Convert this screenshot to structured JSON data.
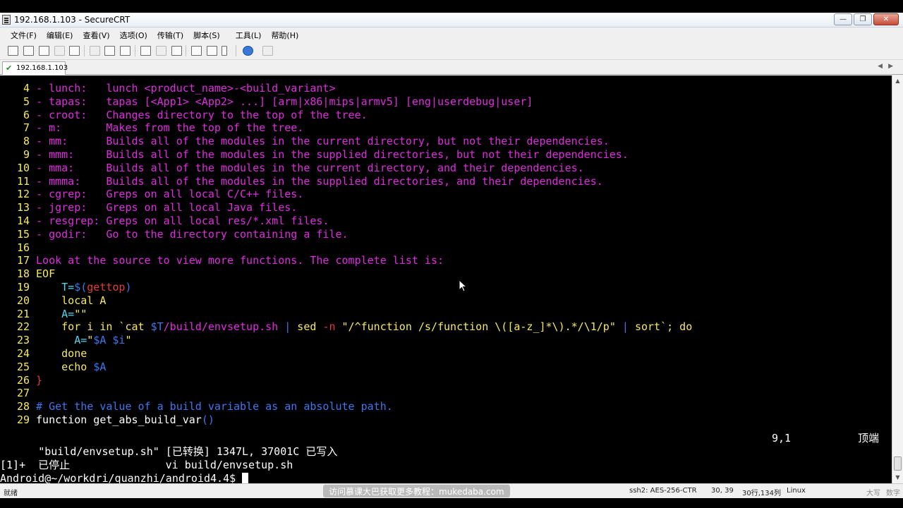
{
  "window": {
    "title": "192.168.1.103 - SecureCRT",
    "controls": [
      "—",
      "❐",
      "✕"
    ]
  },
  "menu": [
    "文件(F)",
    "编辑(E)",
    "查看(V)",
    "选项(O)",
    "传输(T)",
    "脚本(S)",
    "工具(L)",
    "帮助(H)"
  ],
  "tabs": [
    {
      "label": "192.168.1.103",
      "status": "connected"
    }
  ],
  "terminal": {
    "lines": [
      {
        "n": "4",
        "segs": [
          [
            "m",
            " - lunch:   lunch <product_name>-<build_variant>"
          ]
        ]
      },
      {
        "n": "5",
        "segs": [
          [
            "m",
            " - tapas:   tapas [<App1> <App2> ...] [arm|x86|mips|armv5] [eng|userdebug|user]"
          ]
        ]
      },
      {
        "n": "6",
        "segs": [
          [
            "m",
            " - croot:   Changes directory to the top of the tree."
          ]
        ]
      },
      {
        "n": "7",
        "segs": [
          [
            "m",
            " - m:       Makes from the top of the tree."
          ]
        ]
      },
      {
        "n": "8",
        "segs": [
          [
            "m",
            " - mm:      Builds all of the modules in the current directory, but not their dependencies."
          ]
        ]
      },
      {
        "n": "9",
        "segs": [
          [
            "m",
            " - mmm:     Builds all of the modules in the supplied directories, but not their dependencies."
          ]
        ]
      },
      {
        "n": "10",
        "segs": [
          [
            "m",
            " - mma:     Builds all of the modules in the current directory, and their dependencies."
          ]
        ]
      },
      {
        "n": "11",
        "segs": [
          [
            "m",
            " - mmma:    Builds all of the modules in the supplied directories, and their dependencies."
          ]
        ]
      },
      {
        "n": "12",
        "segs": [
          [
            "m",
            " - cgrep:   Greps on all local C/C++ files."
          ]
        ]
      },
      {
        "n": "13",
        "segs": [
          [
            "m",
            " - jgrep:   Greps on all local Java files."
          ]
        ]
      },
      {
        "n": "14",
        "segs": [
          [
            "m",
            " - resgrep: Greps on all local res/*.xml files."
          ]
        ]
      },
      {
        "n": "15",
        "segs": [
          [
            "m",
            " - godir:   Go to the directory containing a file."
          ]
        ]
      },
      {
        "n": "16",
        "segs": []
      },
      {
        "n": "17",
        "segs": [
          [
            "m",
            " Look at the source to view more functions. The complete list is:"
          ]
        ]
      },
      {
        "n": "18",
        "segs": [
          [
            "y",
            " EOF"
          ]
        ]
      },
      {
        "n": "19",
        "segs": [
          [
            "c",
            "     T="
          ],
          [
            "b",
            "$("
          ],
          [
            "r",
            "gettop"
          ],
          [
            "b",
            ")"
          ]
        ]
      },
      {
        "n": "20",
        "segs": [
          [
            "y",
            "     local A"
          ]
        ]
      },
      {
        "n": "21",
        "segs": [
          [
            "c",
            "     A="
          ],
          [
            "y",
            "\"\""
          ]
        ]
      },
      {
        "n": "22",
        "segs": [
          [
            "y",
            "     for i in `cat "
          ],
          [
            "b",
            "$T"
          ],
          [
            "m",
            "/build/envsetup.sh"
          ],
          [
            "y",
            " "
          ],
          [
            "b",
            "|"
          ],
          [
            "y",
            " sed "
          ],
          [
            "r",
            "-n"
          ],
          [
            "y",
            " \"/^function /s/function \\([a-z_]*\\).*/\\1/p\" "
          ],
          [
            "b",
            "|"
          ],
          [
            "y",
            " sort`; do"
          ]
        ]
      },
      {
        "n": "23",
        "segs": [
          [
            "c",
            "       A="
          ],
          [
            "y",
            "\""
          ],
          [
            "b",
            "$A $i"
          ],
          [
            "y",
            "\""
          ]
        ]
      },
      {
        "n": "24",
        "segs": [
          [
            "y",
            "     done"
          ]
        ]
      },
      {
        "n": "25",
        "segs": [
          [
            "y",
            "     echo "
          ],
          [
            "b",
            "$A"
          ]
        ]
      },
      {
        "n": "26",
        "segs": [
          [
            "r",
            " }"
          ]
        ]
      },
      {
        "n": "27",
        "segs": []
      },
      {
        "n": "28",
        "segs": [
          [
            "b",
            " # Get the value of a build variable as an absolute path."
          ]
        ]
      },
      {
        "n": "29",
        "segs": [
          [
            "w",
            " function get_abs_build_var"
          ],
          [
            "b",
            "()"
          ]
        ]
      }
    ],
    "vim_status_left": "\"build/envsetup.sh\" [已转换] 1347L, 37001C 已写入",
    "vim_status_pos": "9,1",
    "vim_status_right": "顶端",
    "job_line": "[1]+  已停止               vi build/envsetup.sh",
    "prompt": "Android@~/workdri/quanzhi/android4.4$ "
  },
  "status": {
    "ready": "就绪",
    "cipher": "ssh2: AES-256-CTR",
    "cursor": "30, 39",
    "size": "30行,134列",
    "os": "Linux",
    "caps": "大写",
    "num": "数字"
  },
  "watermark": "访问慕课大巴获取更多教程：mukedaba.com",
  "colors": {
    "terminal_bg": "#000000",
    "magenta": "#e02be0",
    "yellow": "#f5e95f",
    "cyan": "#4fd8f0",
    "red": "#e23a3a",
    "blue": "#3d77ef"
  }
}
